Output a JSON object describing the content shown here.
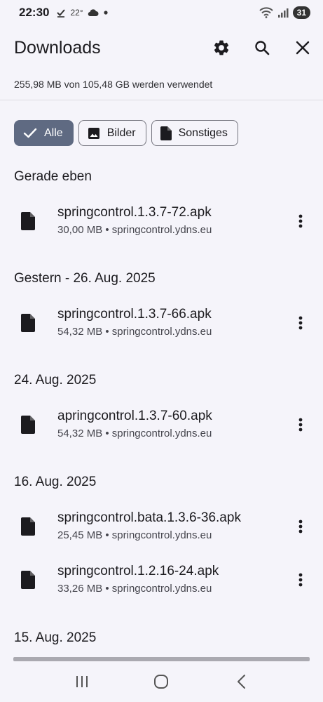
{
  "status": {
    "time": "22:30",
    "temp": "22°",
    "battery": "31"
  },
  "header": {
    "title": "Downloads"
  },
  "storage": {
    "text": "255,98 MB von 105,48 GB werden verwendet"
  },
  "filters": [
    {
      "label": "Alle",
      "selected": true
    },
    {
      "label": "Bilder",
      "selected": false
    },
    {
      "label": "Sonstiges",
      "selected": false
    }
  ],
  "sections": [
    {
      "title": "Gerade eben"
    },
    {
      "title": "Gestern - 26. Aug. 2025"
    },
    {
      "title": "24. Aug. 2025"
    },
    {
      "title": "16. Aug. 2025"
    },
    {
      "title": "15. Aug. 2025"
    }
  ],
  "items": [
    {
      "name": "springcontrol.1.3.7-72.apk",
      "meta": "30,00 MB • springcontrol.ydns.eu"
    },
    {
      "name": "springcontrol.1.3.7-66.apk",
      "meta": "54,32 MB • springcontrol.ydns.eu"
    },
    {
      "name": "apringcontrol.1.3.7-60.apk",
      "meta": "54,32 MB • springcontrol.ydns.eu"
    },
    {
      "name": "springcontrol.bata.1.3.6-36.apk",
      "meta": "25,45 MB • springcontrol.ydns.eu"
    },
    {
      "name": "springcontrol.1.2.16-24.apk",
      "meta": "33,26 MB • springcontrol.ydns.eu"
    }
  ],
  "icons": {
    "settings": "gear-icon",
    "search": "search-icon",
    "close": "close-icon",
    "file": "file-icon",
    "more": "more-vert-icon"
  }
}
